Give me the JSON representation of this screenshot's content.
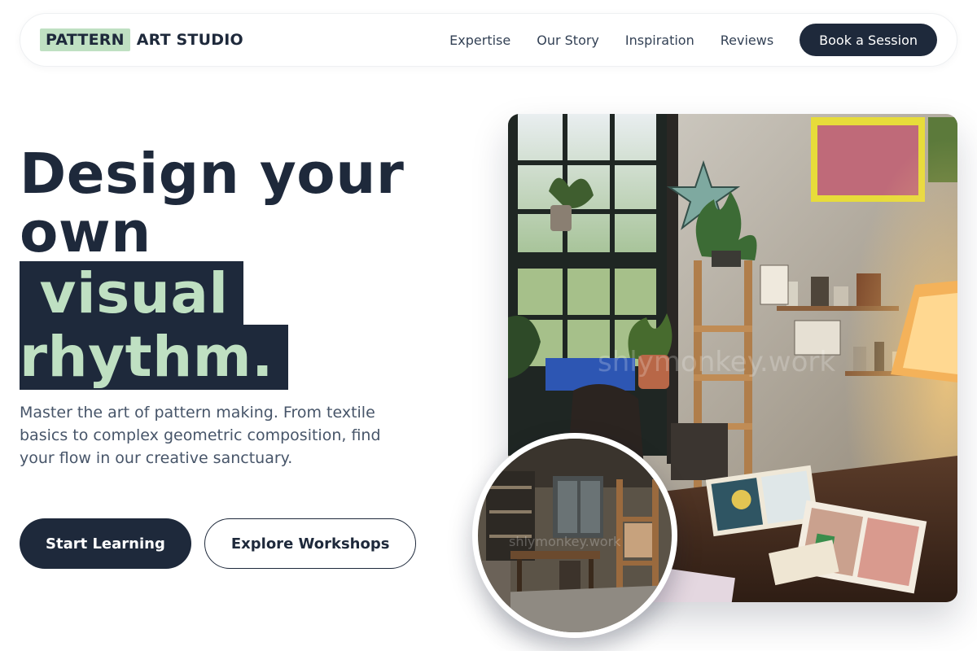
{
  "brand": {
    "highlight": "PATTERN",
    "rest": "ART STUDIO",
    "highlight_color": "#bfe0c2",
    "dark_color": "#1e293b"
  },
  "nav": {
    "links": [
      "Expertise",
      "Our Story",
      "Inspiration",
      "Reviews"
    ],
    "cta_label": "Book a Session"
  },
  "hero": {
    "title_line1": "Design your",
    "title_line2": "own",
    "title_highlight_line1": "visual",
    "title_highlight_line2": "rhythm.",
    "description": "Master the art of pattern making. From textile basics to complex geometric composition, find your flow in our creative sanctuary.",
    "primary_button": "Start Learning",
    "secondary_button": "Explore Workshops"
  },
  "images": {
    "main_photo": "art-studio-photo",
    "circle_photo": "studio-interior-photo",
    "watermark": "shlymonkey.work"
  }
}
